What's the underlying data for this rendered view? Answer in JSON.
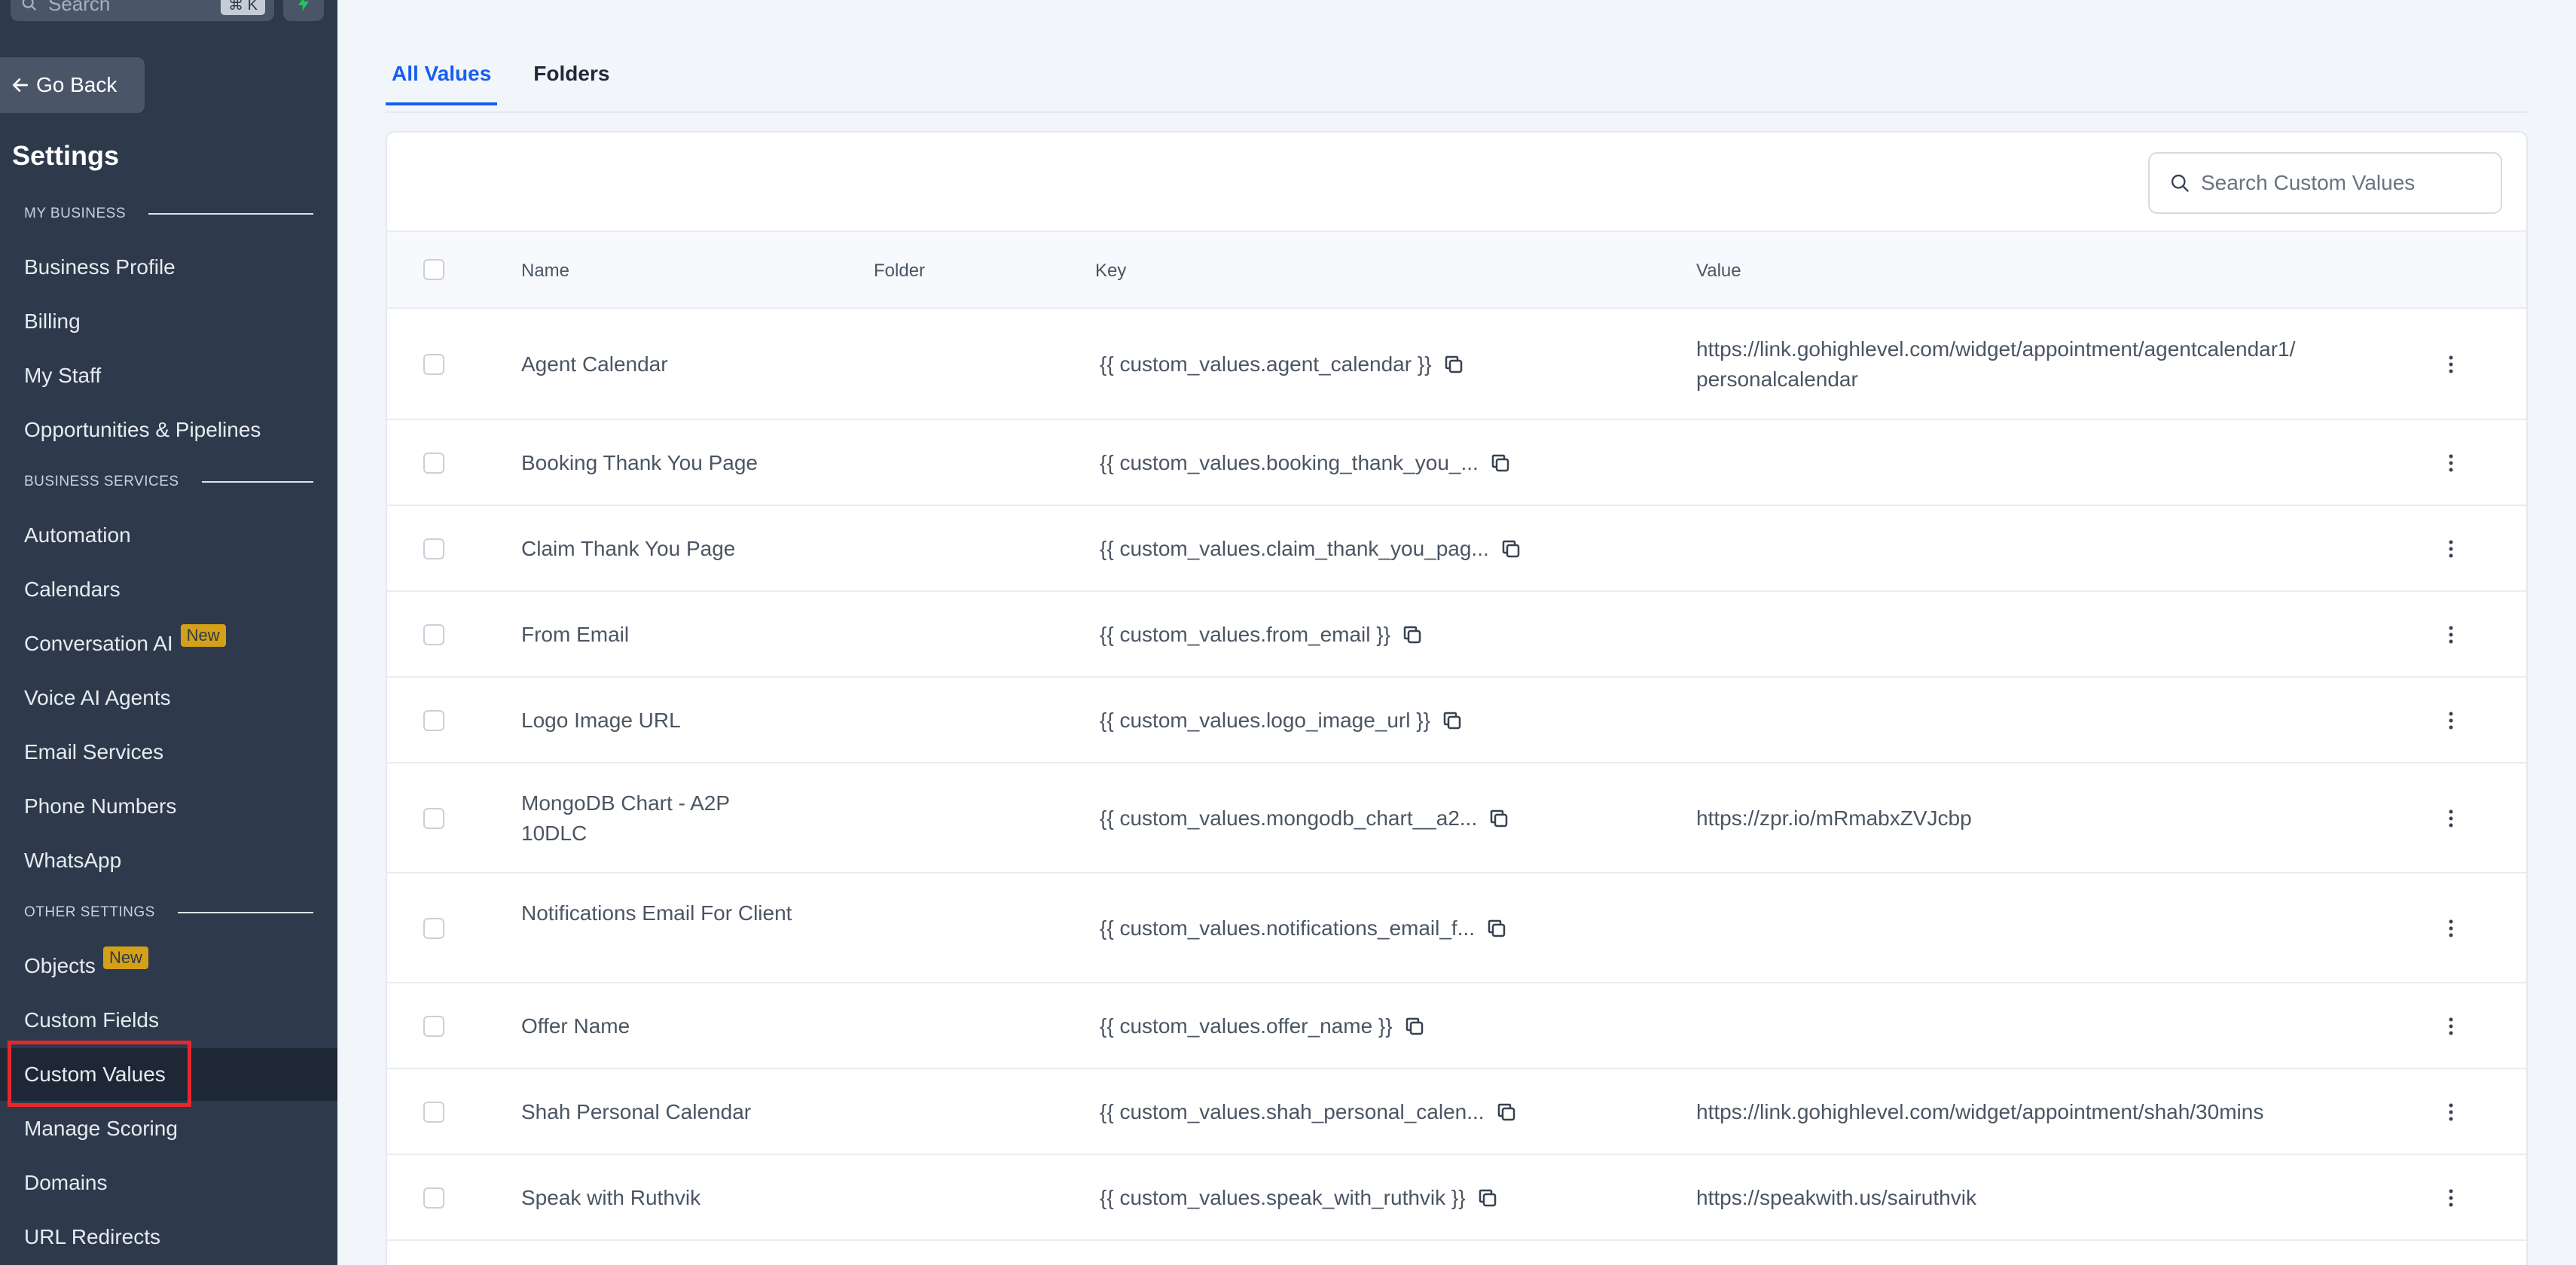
{
  "sidebar": {
    "search_placeholder": "Search",
    "search_shortcut": "⌘ K",
    "go_back": "Go Back",
    "title": "Settings",
    "sections": [
      "MY BUSINESS",
      "BUSINESS SERVICES",
      "OTHER SETTINGS"
    ],
    "items": [
      {
        "label": "Business Profile"
      },
      {
        "label": "Billing"
      },
      {
        "label": "My Staff"
      },
      {
        "label": "Opportunities & Pipelines"
      },
      {
        "label": "Automation"
      },
      {
        "label": "Calendars"
      },
      {
        "label": "Conversation AI",
        "badge": "New"
      },
      {
        "label": "Voice AI Agents"
      },
      {
        "label": "Email Services"
      },
      {
        "label": "Phone Numbers"
      },
      {
        "label": "WhatsApp"
      },
      {
        "label": "Objects",
        "badge": "New"
      },
      {
        "label": "Custom Fields"
      },
      {
        "label": "Custom Values",
        "active": true
      },
      {
        "label": "Manage Scoring"
      },
      {
        "label": "Domains"
      },
      {
        "label": "URL Redirects"
      }
    ]
  },
  "main": {
    "tabs": [
      {
        "label": "All Values",
        "active": true
      },
      {
        "label": "Folders"
      }
    ],
    "search_placeholder": "Search Custom Values",
    "columns": {
      "name": "Name",
      "folder": "Folder",
      "key": "Key",
      "value": "Value"
    },
    "rows": [
      {
        "name": "Agent Calendar",
        "folder": "",
        "key": "{{ custom_values.agent_calendar }}",
        "value": "https://link.gohighlevel.com/widget/appointment/agentcalendar1/ personalcalendar"
      },
      {
        "name": "Booking Thank You Page",
        "folder": "",
        "key": "{{ custom_values.booking_thank_you_...",
        "value": ""
      },
      {
        "name": "Claim Thank You Page",
        "folder": "",
        "key": "{{ custom_values.claim_thank_you_pag...",
        "value": ""
      },
      {
        "name": "From Email",
        "folder": "",
        "key": "{{ custom_values.from_email }}",
        "value": ""
      },
      {
        "name": "Logo Image URL",
        "folder": "",
        "key": "{{ custom_values.logo_image_url }}",
        "value": ""
      },
      {
        "name": "MongoDB Chart - A2P 10DLC",
        "folder": "",
        "key": "{{ custom_values.mongodb_chart__a2...",
        "value": "https://zpr.io/mRmabxZVJcbp"
      },
      {
        "name": "Notifications Email For Client",
        "folder": "",
        "key": "{{ custom_values.notifications_email_f...",
        "value": ""
      },
      {
        "name": "Offer Name",
        "folder": "",
        "key": "{{ custom_values.offer_name }}",
        "value": ""
      },
      {
        "name": "Shah Personal Calendar",
        "folder": "",
        "key": "{{ custom_values.shah_personal_calen...",
        "value": "https://link.gohighlevel.com/widget/appointment/shah/30mins"
      },
      {
        "name": "Speak with Ruthvik",
        "folder": "",
        "key": "{{ custom_values.speak_with_ruthvik }}",
        "value": "https://speakwith.us/sairuthvik"
      }
    ]
  },
  "colors": {
    "sidebar_bg": "#2e3a4b",
    "sidebar_active_bg": "#1d2735",
    "accent": "#155eef",
    "badge": "#d4a017",
    "highlight": "#e8262c"
  }
}
